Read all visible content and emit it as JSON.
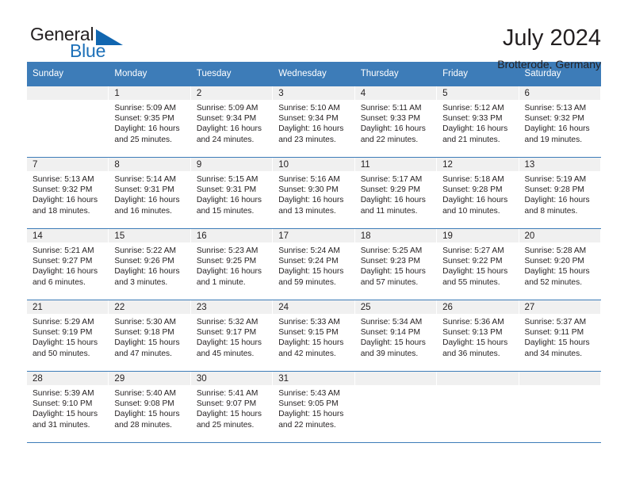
{
  "brand": {
    "name_top": "General",
    "name_bottom": "Blue",
    "triangle_color": "#1166b0",
    "blue_color": "#1d70b8"
  },
  "header": {
    "title": "July 2024",
    "subtitle": "Brotterode, Germany"
  },
  "theme": {
    "header_blue": "#3d7cb8",
    "daynum_band": "#f0f0f0"
  },
  "calendar": {
    "weekday_headers": [
      "Sunday",
      "Monday",
      "Tuesday",
      "Wednesday",
      "Thursday",
      "Friday",
      "Saturday"
    ],
    "weeks": [
      [
        {
          "day": "",
          "sunrise": "",
          "sunset": "",
          "daylight1": "",
          "daylight2": ""
        },
        {
          "day": "1",
          "sunrise": "Sunrise: 5:09 AM",
          "sunset": "Sunset: 9:35 PM",
          "daylight1": "Daylight: 16 hours",
          "daylight2": "and 25 minutes."
        },
        {
          "day": "2",
          "sunrise": "Sunrise: 5:09 AM",
          "sunset": "Sunset: 9:34 PM",
          "daylight1": "Daylight: 16 hours",
          "daylight2": "and 24 minutes."
        },
        {
          "day": "3",
          "sunrise": "Sunrise: 5:10 AM",
          "sunset": "Sunset: 9:34 PM",
          "daylight1": "Daylight: 16 hours",
          "daylight2": "and 23 minutes."
        },
        {
          "day": "4",
          "sunrise": "Sunrise: 5:11 AM",
          "sunset": "Sunset: 9:33 PM",
          "daylight1": "Daylight: 16 hours",
          "daylight2": "and 22 minutes."
        },
        {
          "day": "5",
          "sunrise": "Sunrise: 5:12 AM",
          "sunset": "Sunset: 9:33 PM",
          "daylight1": "Daylight: 16 hours",
          "daylight2": "and 21 minutes."
        },
        {
          "day": "6",
          "sunrise": "Sunrise: 5:13 AM",
          "sunset": "Sunset: 9:32 PM",
          "daylight1": "Daylight: 16 hours",
          "daylight2": "and 19 minutes."
        }
      ],
      [
        {
          "day": "7",
          "sunrise": "Sunrise: 5:13 AM",
          "sunset": "Sunset: 9:32 PM",
          "daylight1": "Daylight: 16 hours",
          "daylight2": "and 18 minutes."
        },
        {
          "day": "8",
          "sunrise": "Sunrise: 5:14 AM",
          "sunset": "Sunset: 9:31 PM",
          "daylight1": "Daylight: 16 hours",
          "daylight2": "and 16 minutes."
        },
        {
          "day": "9",
          "sunrise": "Sunrise: 5:15 AM",
          "sunset": "Sunset: 9:31 PM",
          "daylight1": "Daylight: 16 hours",
          "daylight2": "and 15 minutes."
        },
        {
          "day": "10",
          "sunrise": "Sunrise: 5:16 AM",
          "sunset": "Sunset: 9:30 PM",
          "daylight1": "Daylight: 16 hours",
          "daylight2": "and 13 minutes."
        },
        {
          "day": "11",
          "sunrise": "Sunrise: 5:17 AM",
          "sunset": "Sunset: 9:29 PM",
          "daylight1": "Daylight: 16 hours",
          "daylight2": "and 11 minutes."
        },
        {
          "day": "12",
          "sunrise": "Sunrise: 5:18 AM",
          "sunset": "Sunset: 9:28 PM",
          "daylight1": "Daylight: 16 hours",
          "daylight2": "and 10 minutes."
        },
        {
          "day": "13",
          "sunrise": "Sunrise: 5:19 AM",
          "sunset": "Sunset: 9:28 PM",
          "daylight1": "Daylight: 16 hours",
          "daylight2": "and 8 minutes."
        }
      ],
      [
        {
          "day": "14",
          "sunrise": "Sunrise: 5:21 AM",
          "sunset": "Sunset: 9:27 PM",
          "daylight1": "Daylight: 16 hours",
          "daylight2": "and 6 minutes."
        },
        {
          "day": "15",
          "sunrise": "Sunrise: 5:22 AM",
          "sunset": "Sunset: 9:26 PM",
          "daylight1": "Daylight: 16 hours",
          "daylight2": "and 3 minutes."
        },
        {
          "day": "16",
          "sunrise": "Sunrise: 5:23 AM",
          "sunset": "Sunset: 9:25 PM",
          "daylight1": "Daylight: 16 hours",
          "daylight2": "and 1 minute."
        },
        {
          "day": "17",
          "sunrise": "Sunrise: 5:24 AM",
          "sunset": "Sunset: 9:24 PM",
          "daylight1": "Daylight: 15 hours",
          "daylight2": "and 59 minutes."
        },
        {
          "day": "18",
          "sunrise": "Sunrise: 5:25 AM",
          "sunset": "Sunset: 9:23 PM",
          "daylight1": "Daylight: 15 hours",
          "daylight2": "and 57 minutes."
        },
        {
          "day": "19",
          "sunrise": "Sunrise: 5:27 AM",
          "sunset": "Sunset: 9:22 PM",
          "daylight1": "Daylight: 15 hours",
          "daylight2": "and 55 minutes."
        },
        {
          "day": "20",
          "sunrise": "Sunrise: 5:28 AM",
          "sunset": "Sunset: 9:20 PM",
          "daylight1": "Daylight: 15 hours",
          "daylight2": "and 52 minutes."
        }
      ],
      [
        {
          "day": "21",
          "sunrise": "Sunrise: 5:29 AM",
          "sunset": "Sunset: 9:19 PM",
          "daylight1": "Daylight: 15 hours",
          "daylight2": "and 50 minutes."
        },
        {
          "day": "22",
          "sunrise": "Sunrise: 5:30 AM",
          "sunset": "Sunset: 9:18 PM",
          "daylight1": "Daylight: 15 hours",
          "daylight2": "and 47 minutes."
        },
        {
          "day": "23",
          "sunrise": "Sunrise: 5:32 AM",
          "sunset": "Sunset: 9:17 PM",
          "daylight1": "Daylight: 15 hours",
          "daylight2": "and 45 minutes."
        },
        {
          "day": "24",
          "sunrise": "Sunrise: 5:33 AM",
          "sunset": "Sunset: 9:15 PM",
          "daylight1": "Daylight: 15 hours",
          "daylight2": "and 42 minutes."
        },
        {
          "day": "25",
          "sunrise": "Sunrise: 5:34 AM",
          "sunset": "Sunset: 9:14 PM",
          "daylight1": "Daylight: 15 hours",
          "daylight2": "and 39 minutes."
        },
        {
          "day": "26",
          "sunrise": "Sunrise: 5:36 AM",
          "sunset": "Sunset: 9:13 PM",
          "daylight1": "Daylight: 15 hours",
          "daylight2": "and 36 minutes."
        },
        {
          "day": "27",
          "sunrise": "Sunrise: 5:37 AM",
          "sunset": "Sunset: 9:11 PM",
          "daylight1": "Daylight: 15 hours",
          "daylight2": "and 34 minutes."
        }
      ],
      [
        {
          "day": "28",
          "sunrise": "Sunrise: 5:39 AM",
          "sunset": "Sunset: 9:10 PM",
          "daylight1": "Daylight: 15 hours",
          "daylight2": "and 31 minutes."
        },
        {
          "day": "29",
          "sunrise": "Sunrise: 5:40 AM",
          "sunset": "Sunset: 9:08 PM",
          "daylight1": "Daylight: 15 hours",
          "daylight2": "and 28 minutes."
        },
        {
          "day": "30",
          "sunrise": "Sunrise: 5:41 AM",
          "sunset": "Sunset: 9:07 PM",
          "daylight1": "Daylight: 15 hours",
          "daylight2": "and 25 minutes."
        },
        {
          "day": "31",
          "sunrise": "Sunrise: 5:43 AM",
          "sunset": "Sunset: 9:05 PM",
          "daylight1": "Daylight: 15 hours",
          "daylight2": "and 22 minutes."
        },
        {
          "day": "",
          "sunrise": "",
          "sunset": "",
          "daylight1": "",
          "daylight2": ""
        },
        {
          "day": "",
          "sunrise": "",
          "sunset": "",
          "daylight1": "",
          "daylight2": ""
        },
        {
          "day": "",
          "sunrise": "",
          "sunset": "",
          "daylight1": "",
          "daylight2": ""
        }
      ]
    ]
  }
}
